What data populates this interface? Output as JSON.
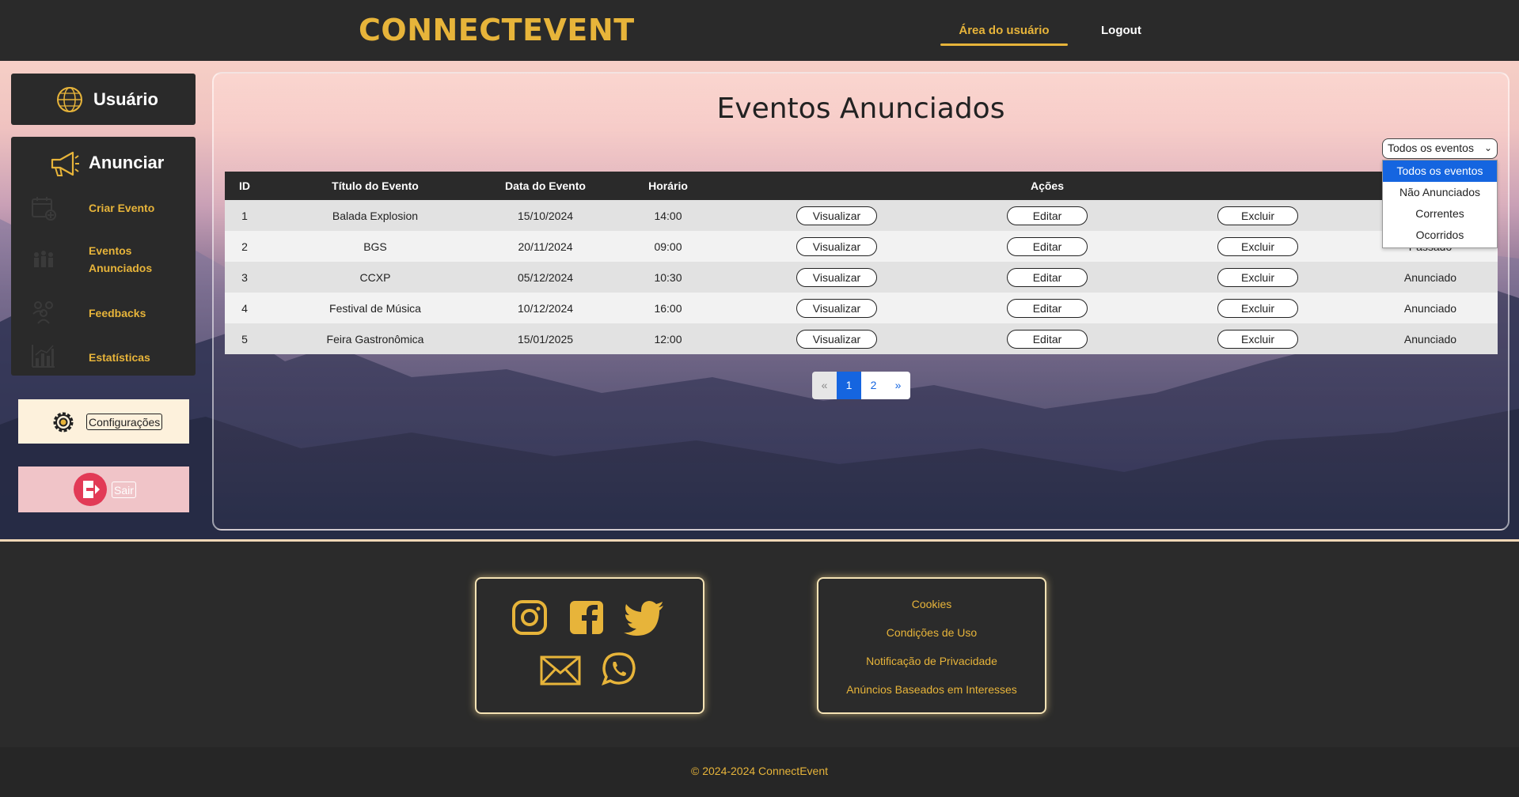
{
  "header": {
    "brand": "CONNECTEVENT",
    "nav_user_area": "Área do usuário",
    "nav_logout": "Logout"
  },
  "sidebar": {
    "user_label": "Usuário",
    "section_title": "Anunciar",
    "items": [
      {
        "label": "Criar Evento",
        "icon": "calendar-add-icon"
      },
      {
        "label": "Eventos Anunciados",
        "icon": "audience-icon"
      },
      {
        "label": "Feedbacks",
        "icon": "people-group-icon"
      },
      {
        "label": "Estatísticas",
        "icon": "bar-chart-icon"
      }
    ],
    "settings_label": "Configurações",
    "exit_label": "Sair"
  },
  "main": {
    "title": "Eventos Anunciados",
    "filter": {
      "selected": "Todos os eventos",
      "options": [
        "Todos os eventos",
        "Não Anunciados",
        "Correntes",
        "Ocorridos"
      ]
    },
    "table": {
      "headers": [
        "ID",
        "Título do Evento",
        "Data do Evento",
        "Horário",
        "Ações"
      ],
      "action_labels": {
        "view": "Visualizar",
        "edit": "Editar",
        "delete": "Excluir"
      },
      "rows": [
        {
          "id": "1",
          "title": "Balada Explosion",
          "date": "15/10/2024",
          "time": "14:00",
          "status": ""
        },
        {
          "id": "2",
          "title": "BGS",
          "date": "20/11/2024",
          "time": "09:00",
          "status": "Passado"
        },
        {
          "id": "3",
          "title": "CCXP",
          "date": "05/12/2024",
          "time": "10:30",
          "status": "Anunciado"
        },
        {
          "id": "4",
          "title": "Festival de Música",
          "date": "10/12/2024",
          "time": "16:00",
          "status": "Anunciado"
        },
        {
          "id": "5",
          "title": "Feira Gastronômica",
          "date": "15/01/2025",
          "time": "12:00",
          "status": "Anunciado"
        }
      ]
    },
    "pagination": {
      "prev": "«",
      "pages": [
        "1",
        "2"
      ],
      "current": "1",
      "next": "»"
    }
  },
  "footer": {
    "social_icons": [
      "instagram-icon",
      "facebook-icon",
      "twitter-icon",
      "email-icon",
      "whatsapp-icon"
    ],
    "links": [
      "Cookies",
      "Condições de Uso",
      "Notificação de Privacidade",
      "Anúncios Baseados em Interesses"
    ],
    "copyright": "© 2024-2024 ConnectEvent"
  },
  "colors": {
    "accent": "#e7b43a",
    "dark": "#2a2a2a",
    "link_blue": "#1565e0",
    "exit_red": "#e23a56"
  }
}
